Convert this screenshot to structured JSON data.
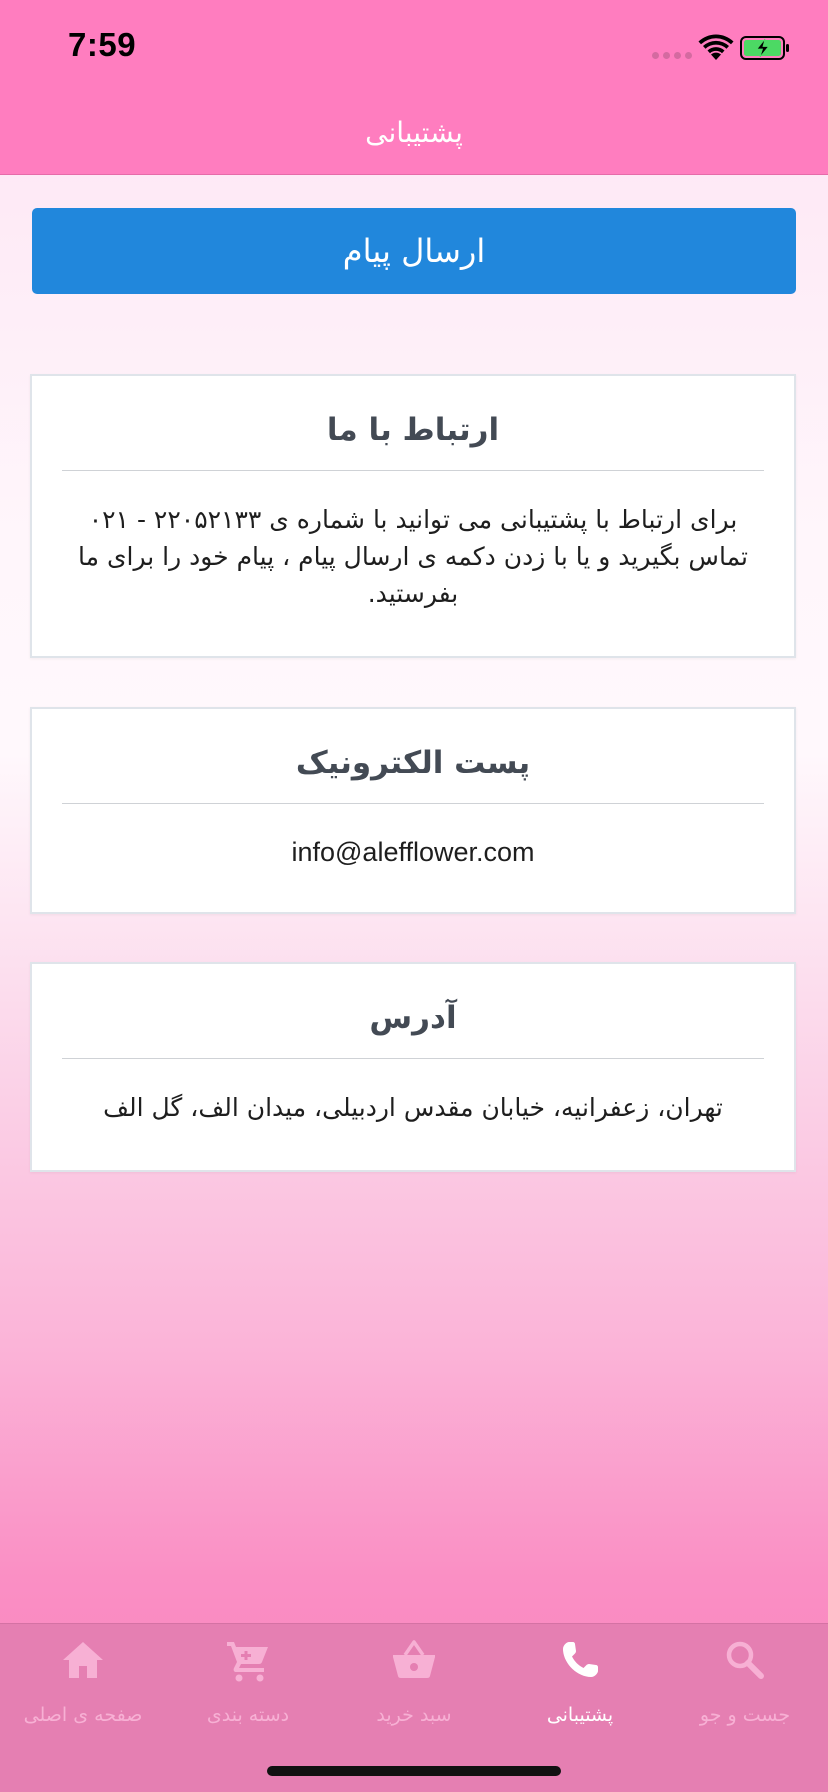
{
  "status_bar": {
    "time": "7:59"
  },
  "header": {
    "title": "پشتیبانی"
  },
  "actions": {
    "send_message_label": "ارسال پیام"
  },
  "cards": [
    {
      "title": "ارتباط با ما",
      "body": "برای ارتباط با پشتیبانی می توانید با شماره ی ۲۲۰۵۲۱۳۳ - ۰۲۱ تماس بگیرید و یا با زدن دکمه ی ارسال پیام ، پیام خود را برای ما بفرستید."
    },
    {
      "title": "پست الکترونیک",
      "body": "info@alefflower.com"
    },
    {
      "title": "آدرس",
      "body": "تهران، زعفرانیه، خیابان مقدس اردبیلی، میدان الف، گل الف"
    }
  ],
  "tab_bar": {
    "items": [
      {
        "label": "جست و جو",
        "icon": "search-icon",
        "active": false
      },
      {
        "label": "پشتیبانی",
        "icon": "phone-icon",
        "active": true
      },
      {
        "label": "سبد خرید",
        "icon": "basket-icon",
        "active": false
      },
      {
        "label": "دسته بندی",
        "icon": "cart-icon",
        "active": false
      },
      {
        "label": "صفحه ی اصلی",
        "icon": "home-icon",
        "active": false
      }
    ]
  },
  "colors": {
    "header_bg": "#ff7dbf",
    "button_bg": "#2187dc",
    "tab_bar_bg": "#e57fb2",
    "tab_inactive": "#f7b0d4",
    "tab_active": "#ffffff",
    "battery_fill": "#4cd964"
  }
}
